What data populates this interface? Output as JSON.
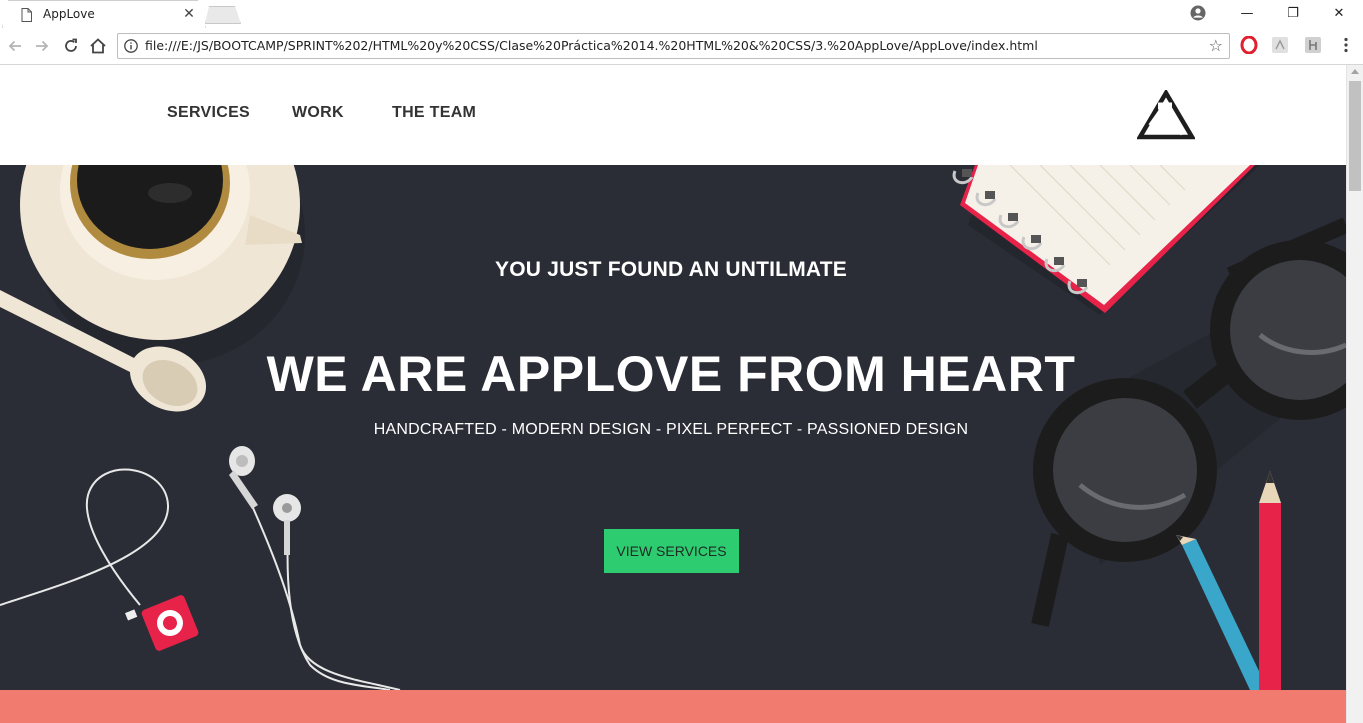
{
  "browser": {
    "tab_title": "AppLove",
    "tab_close": "✕",
    "url": "file:///E:/JS/BOOTCAMP/SPRINT%202/HTML%20y%20CSS/Clase%20Práctica%2014.%20HTML%20&%20CSS/3.%20AppLove/AppLove/index.html",
    "window_controls": {
      "minimize": "—",
      "restore": "❐",
      "close": "✕"
    },
    "icons": [
      "back-icon",
      "forward-icon",
      "reload-icon",
      "home-icon",
      "info-icon",
      "star-icon",
      "opera-icon",
      "pdf-icon",
      "extension-icon",
      "menu-icon",
      "profile-icon"
    ],
    "star": "☆"
  },
  "nav": {
    "items": [
      {
        "label": "SERVICES"
      },
      {
        "label": "WORK"
      },
      {
        "label": "THE TEAM"
      }
    ]
  },
  "hero": {
    "subtitle": "YOU JUST FOUND AN UNTILMATE",
    "title": "WE ARE APPLOVE FROM HEART",
    "tagline": "HANDCRAFTED - MODERN DESIGN - PIXEL PERFECT - PASSIONED DESIGN",
    "cta_label": "VIEW SERVICES"
  },
  "colors": {
    "hero_bg": "#2a2d36",
    "cta_bg": "#2ecc71",
    "band": "#f27b70",
    "accent_red": "#e8234a",
    "pencil_blue": "#3aa6c9"
  }
}
